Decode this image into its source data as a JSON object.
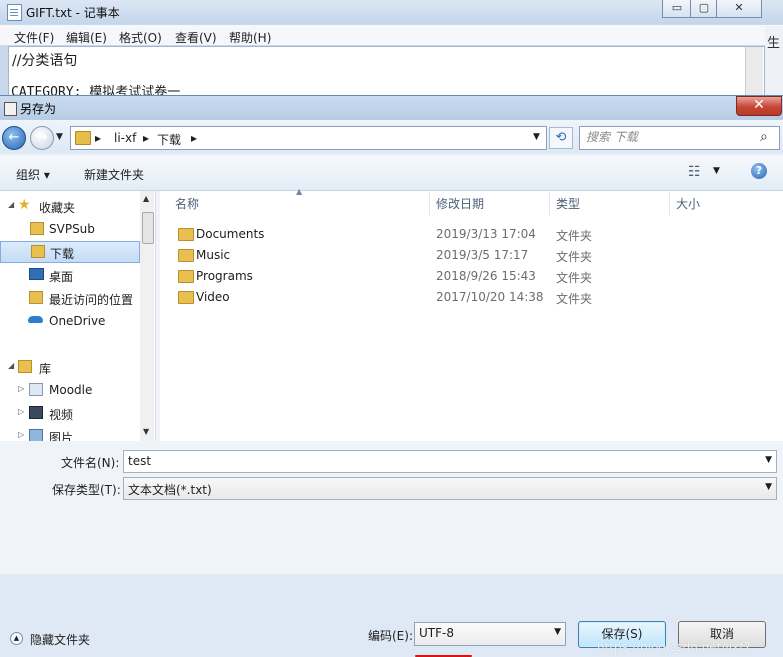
{
  "notepad": {
    "title": "GIFT.txt - 记事本",
    "caption_buttons": [
      "▭",
      "▢",
      "✕"
    ],
    "menu": [
      "文件(F)",
      "编辑(E)",
      "格式(O)",
      "查看(V)",
      "帮助(H)"
    ],
    "text_line1": "//分类语句",
    "text_line2": "CATEGORY: 模拟考试试卷一",
    "side_text": "生"
  },
  "dialog": {
    "title": "另存为",
    "close_label": "✕",
    "address": {
      "sep": "▸",
      "crumb1": "li-xf",
      "crumb2": "下载",
      "dropdown": "▼"
    },
    "refresh_icon": "⟲",
    "search_placeholder": "搜索 下载",
    "search_icon": "⌕",
    "toolbar": {
      "organize": "组织 ▾",
      "new_folder": "新建文件夹",
      "view_icon": "☷",
      "view_dropdown": "▼",
      "help_icon": "?"
    },
    "nav_tree": {
      "favorites": "收藏夹",
      "svpsub": "SVPSub",
      "downloads": "下载",
      "desktop": "桌面",
      "recent": "最近访问的位置",
      "onedrive": "OneDrive",
      "library": "库",
      "moodle": "Moodle",
      "videos": "视频",
      "pictures": "图片"
    },
    "columns": {
      "name": "名称",
      "date": "修改日期",
      "type": "类型",
      "size": "大小"
    },
    "files": [
      {
        "name": "Documents",
        "date": "2019/3/13 17:04",
        "type": "文件夹"
      },
      {
        "name": "Music",
        "date": "2019/3/5 17:17",
        "type": "文件夹"
      },
      {
        "name": "Programs",
        "date": "2018/9/26 15:43",
        "type": "文件夹"
      },
      {
        "name": "Video",
        "date": "2017/10/20 14:38",
        "type": "文件夹"
      }
    ],
    "filename_label": "文件名(N):",
    "filename_value": "test",
    "filetype_label": "保存类型(T):",
    "filetype_value": "文本文档(*.txt)",
    "hide_folders": "隐藏文件夹",
    "encoding_label": "编码(E):",
    "encoding_value": "UTF-8",
    "save": "保存(S)",
    "cancel": "取消",
    "watermark": "https://blog.csdn.net/lixf7"
  },
  "colors": {
    "accent": "#3c7fb1",
    "close": "#c74634",
    "annotation": "#e01010"
  }
}
